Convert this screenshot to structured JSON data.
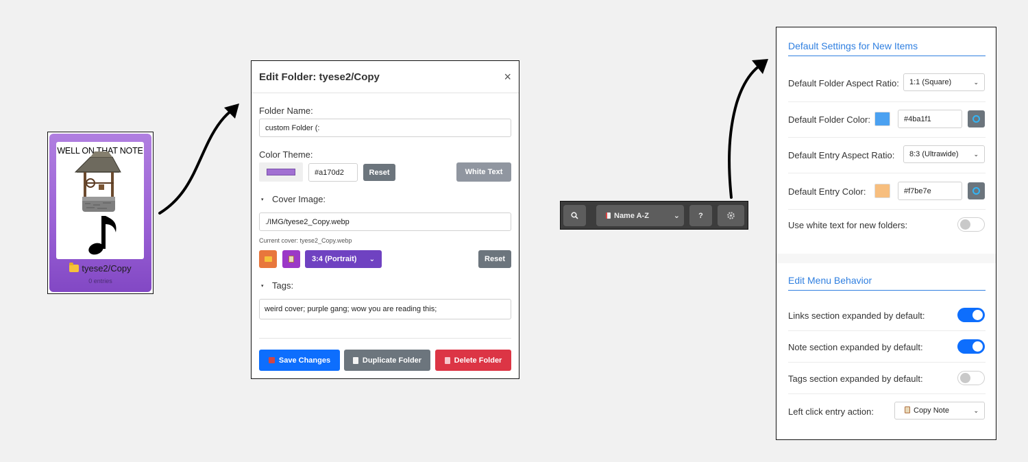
{
  "card": {
    "cover_text": "WELL ON THAT NOTE",
    "name": "tyese2/Copy",
    "count": "0 entries"
  },
  "dialog": {
    "title": "Edit Folder: tyese2/Copy",
    "close": "×",
    "folder_name_label": "Folder Name:",
    "folder_name_value": "custom Folder (:",
    "color_theme_label": "Color Theme:",
    "color_hex": "#a170d2",
    "swatch_color": "#a170d2",
    "reset_label": "Reset",
    "white_text_label": "White Text",
    "cover_label": "Cover Image:",
    "cover_value": "./IMG/tyese2_Copy.webp",
    "current_cover": "Current cover: tyese2_Copy.webp",
    "aspect_select": "3:4 (Portrait)",
    "cover_reset_label": "Reset",
    "tags_label": "Tags:",
    "tags_value": "weird cover; purple gang; wow you are reading this;",
    "save_label": "Save Changes",
    "duplicate_label": "Duplicate Folder",
    "delete_label": "Delete Folder",
    "colors": {
      "save": "#0d6efd",
      "duplicate": "#6c757d",
      "delete": "#dc3545",
      "upload": "#e8773c",
      "paste": "#9b38c7",
      "aspect": "#6f42c1"
    }
  },
  "toolbar": {
    "sort_label": "Name A-Z",
    "help_label": "?"
  },
  "settings": {
    "section1_title": "Default Settings for New Items",
    "folder_aspect_label": "Default Folder Aspect Ratio:",
    "folder_aspect_value": "1:1 (Square)",
    "folder_color_label": "Default Folder Color:",
    "folder_color_value": "#4ba1f1",
    "entry_aspect_label": "Default Entry Aspect Ratio:",
    "entry_aspect_value": "8:3 (Ultrawide)",
    "entry_color_label": "Default Entry Color:",
    "entry_color_value": "#f7be7e",
    "white_text_label": "Use white text for new folders:",
    "white_text_on": false,
    "section2_title": "Edit Menu Behavior",
    "links_label": "Links section expanded by default:",
    "links_on": true,
    "note_label": "Note section expanded by default:",
    "note_on": true,
    "tags_label": "Tags section expanded by default:",
    "tags_on": false,
    "left_click_label": "Left click entry action:",
    "left_click_value": "Copy Note"
  }
}
